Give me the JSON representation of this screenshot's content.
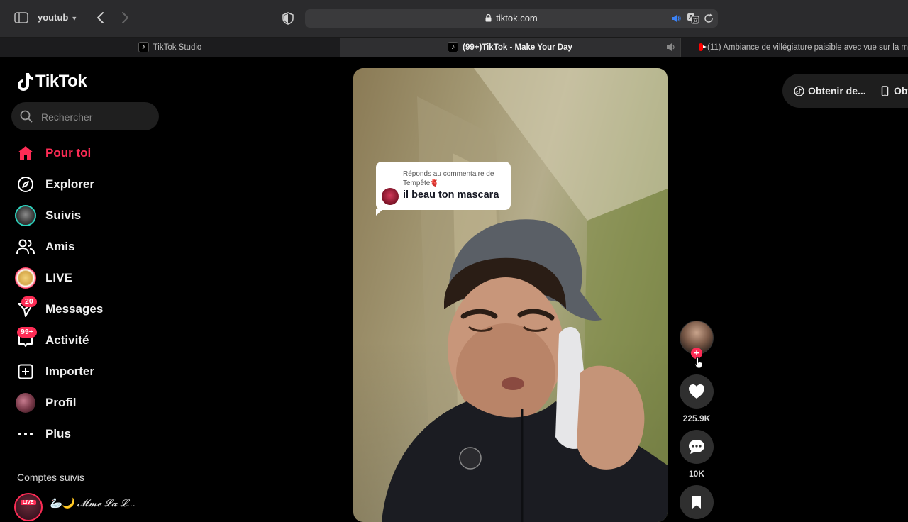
{
  "browser": {
    "profile_name": "youtub",
    "url": "tiktok.com",
    "tabs": [
      {
        "label": "TikTok Studio"
      },
      {
        "label": "(99+)TikTok - Make Your Day"
      },
      {
        "label": "(11) Ambiance de villégiature paisible avec vue sur la m"
      }
    ]
  },
  "app": {
    "brand": "TikTok",
    "search": {
      "placeholder": "Rechercher",
      "value": ""
    },
    "nav": [
      {
        "label": "Pour toi"
      },
      {
        "label": "Explorer"
      },
      {
        "label": "Suivis"
      },
      {
        "label": "Amis"
      },
      {
        "label": "LIVE"
      },
      {
        "label": "Messages",
        "badge": "20"
      },
      {
        "label": "Activité",
        "badge": "99+"
      },
      {
        "label": "Importer"
      },
      {
        "label": "Profil"
      },
      {
        "label": "Plus"
      }
    ],
    "followed": {
      "title": "Comptes suivis",
      "accounts": [
        {
          "name": "🦢🌙 𝓜𝓶𝓮 𝓛𝓪 𝓛...",
          "live_tag": "LIVE"
        }
      ]
    },
    "accent_color": "#fe2c55"
  },
  "video": {
    "reply": {
      "prefix": "Réponds au commentaire de Tempête🫀",
      "comment": "il beau ton mascara"
    },
    "likes": "225.9K",
    "comments": "10K"
  },
  "get_app": {
    "button1": "Obtenir de...",
    "button2": "Obt"
  }
}
